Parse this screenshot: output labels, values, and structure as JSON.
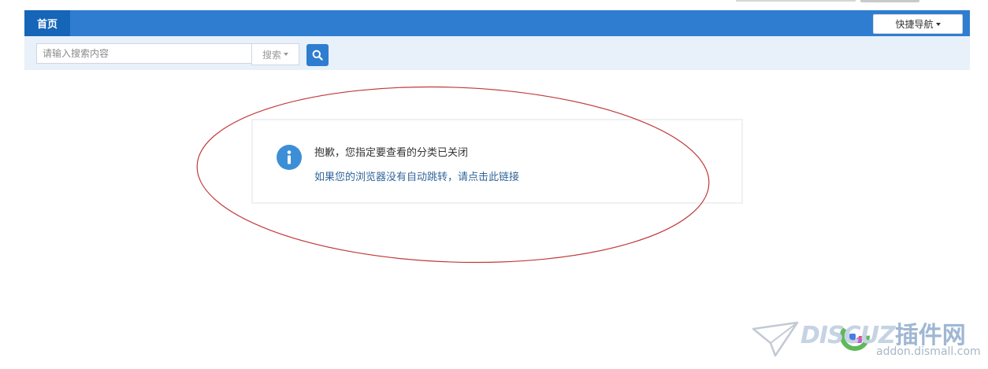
{
  "nav": {
    "home_label": "首页",
    "quick_nav_label": "快捷导航"
  },
  "search": {
    "placeholder": "请输入搜索内容",
    "type_label": "搜索"
  },
  "message": {
    "title": "抱歉，您指定要查看的分类已关闭",
    "link_text": "如果您的浏览器没有自动跳转，请点击此链接"
  },
  "watermark": {
    "brand": "DISCUZ",
    "brand_cn": "插件网",
    "domain": "addon.dismall.com"
  },
  "colors": {
    "nav_bg": "#2e7dd1",
    "nav_active": "#1565b8",
    "search_bar_bg": "#e8f0f9",
    "info_icon": "#3c8fd6",
    "link": "#336699",
    "annotation": "#c0393b"
  },
  "icons": {
    "search_button": "search-icon",
    "message": "info-icon",
    "watermark_logo": "paper-plane-icon"
  }
}
